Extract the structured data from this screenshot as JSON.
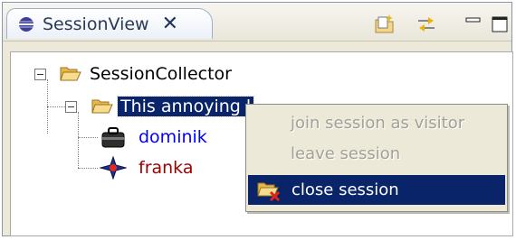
{
  "view": {
    "tab_title": "SessionView",
    "close_glyph": "✕",
    "toolbar": [
      {
        "icon": "new-session-icon"
      },
      {
        "icon": "sync-icon"
      },
      {
        "icon": "minimize-icon"
      },
      {
        "icon": "maximize-icon"
      }
    ]
  },
  "tree": {
    "root": {
      "label": "SessionCollector",
      "expander": "minus"
    },
    "session": {
      "label": "This annoying l",
      "expander": "minus",
      "selected": true
    },
    "members": [
      {
        "label": "dominik",
        "icon": "briefcase-user-icon",
        "color": "#0000ff"
      },
      {
        "label": "franka",
        "icon": "compass-star-user-icon",
        "color": "#a00000"
      }
    ]
  },
  "context_menu": {
    "items": [
      {
        "label": "join session as visitor",
        "enabled": false
      },
      {
        "label": "leave session",
        "enabled": false
      },
      {
        "label": "close session",
        "enabled": true,
        "highlighted": true,
        "icon": "folder-close-icon"
      }
    ]
  },
  "colors": {
    "selection": "#0a246a",
    "disabled_text": "#a3a195",
    "menu_bg": "#ece9d8"
  }
}
